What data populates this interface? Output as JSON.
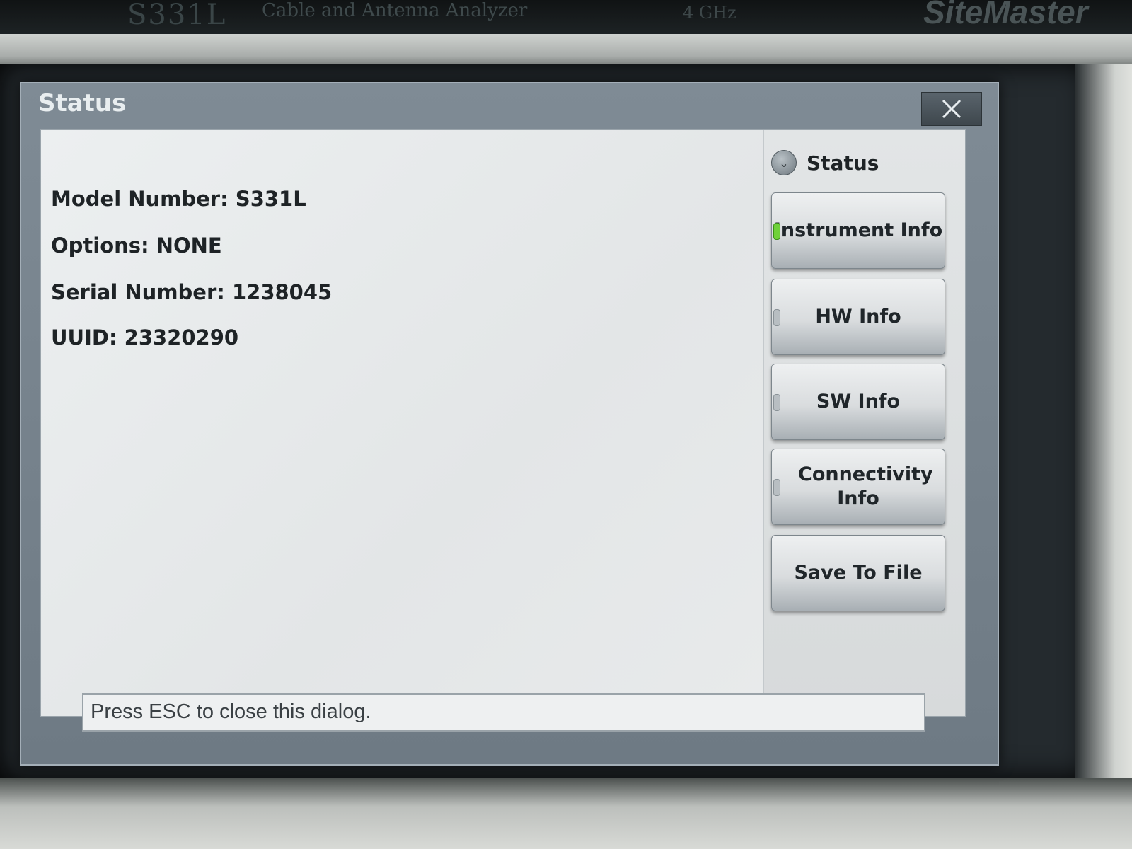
{
  "device": {
    "model_text": "S331L",
    "subtitle": "Cable and Antenna Analyzer",
    "frequency": "4 GHz",
    "brand": "SiteMaster"
  },
  "dialog": {
    "title": "Status",
    "close_icon": "close-icon",
    "info": {
      "model_number": "Model Number: S331L",
      "options": "Options: NONE",
      "serial_number": "Serial Number: 1238045",
      "uuid": "UUID: 23320290"
    },
    "side_panel": {
      "header": "Status",
      "buttons": [
        {
          "label": "Instrument Info",
          "active": true
        },
        {
          "label": "HW Info",
          "active": false
        },
        {
          "label": "SW Info",
          "active": false
        },
        {
          "label": "Connectivity Info",
          "active": false
        },
        {
          "label": "Save To File",
          "active": false
        }
      ]
    },
    "status_message": "Press ESC to close this dialog."
  }
}
